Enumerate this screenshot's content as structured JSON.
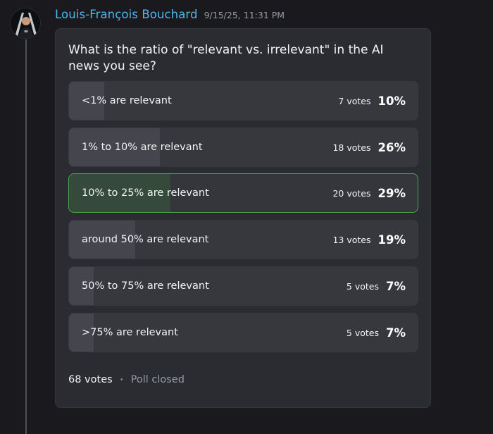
{
  "message": {
    "author": "Louis-François Bouchard",
    "timestamp": "9/15/25, 11:31 PM"
  },
  "poll": {
    "question": "What is the ratio of \"relevant vs. irrelevant\" in the AI news you see?",
    "answers": [
      {
        "label": "<1% are relevant",
        "votes": "7 votes",
        "percent": "10%",
        "fill_fraction": 0.1,
        "selected": false
      },
      {
        "label": "1% to 10% are relevant",
        "votes": "18 votes",
        "percent": "26%",
        "fill_fraction": 0.26,
        "selected": false
      },
      {
        "label": "10% to 25% are relevant",
        "votes": "20 votes",
        "percent": "29%",
        "fill_fraction": 0.29,
        "selected": true
      },
      {
        "label": "around 50% are relevant",
        "votes": "13 votes",
        "percent": "19%",
        "fill_fraction": 0.19,
        "selected": false
      },
      {
        "label": "50% to 75% are relevant",
        "votes": "5 votes",
        "percent": "7%",
        "fill_fraction": 0.07,
        "selected": false
      },
      {
        "label": ">75% are relevant",
        "votes": "5 votes",
        "percent": "7%",
        "fill_fraction": 0.07,
        "selected": false
      }
    ],
    "total_votes": "68 votes",
    "separator": "•",
    "status": "Poll closed"
  },
  "colors": {
    "username": "#4fb6ec",
    "selected_border": "#4aa64f",
    "background": "#1a1a1e",
    "card": "#2b2c31"
  },
  "icons": {
    "avatar": "user-avatar-photo"
  }
}
